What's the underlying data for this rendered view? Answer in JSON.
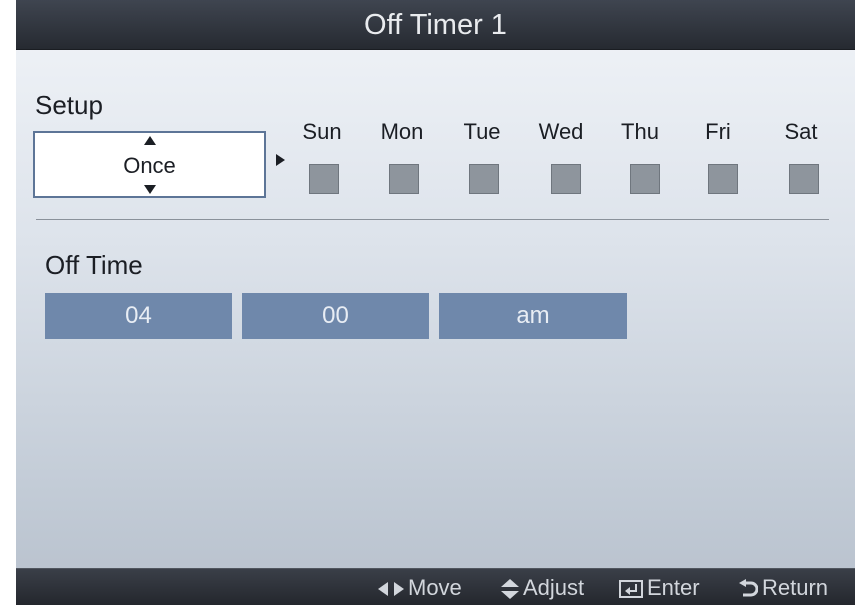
{
  "title": "Off Timer 1",
  "setup": {
    "label": "Setup",
    "value": "Once"
  },
  "days": [
    {
      "label": "Sun",
      "checked": false
    },
    {
      "label": "Mon",
      "checked": false
    },
    {
      "label": "Tue",
      "checked": false
    },
    {
      "label": "Wed",
      "checked": false
    },
    {
      "label": "Thu",
      "checked": false
    },
    {
      "label": "Fri",
      "checked": false
    },
    {
      "label": "Sat",
      "checked": false
    }
  ],
  "off_time": {
    "label": "Off Time",
    "hour": "04",
    "minute": "00",
    "ampm": "am"
  },
  "footer": {
    "move": "Move",
    "adjust": "Adjust",
    "enter": "Enter",
    "return": "Return"
  },
  "colors": {
    "field_bg": "#6f88ab",
    "checkbox": "#8e959d",
    "titlebar": "#2f343c"
  }
}
